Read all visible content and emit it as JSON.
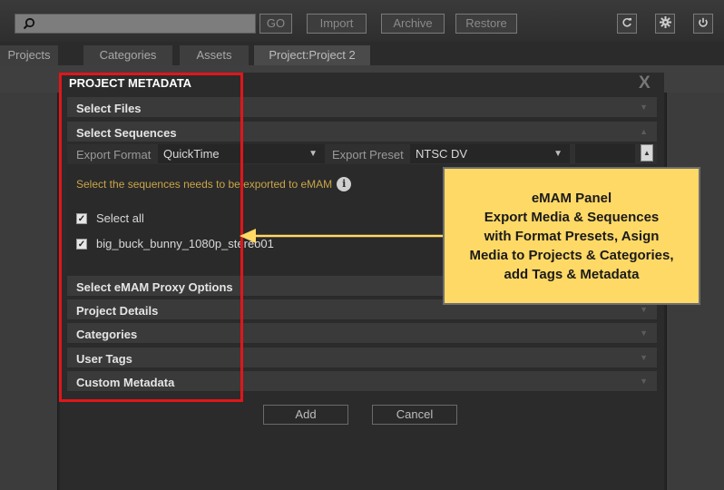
{
  "toolbar": {
    "buttons": {
      "go": "GO",
      "import": "Import",
      "archive": "Archive",
      "restore": "Restore"
    }
  },
  "tabs": [
    "Projects",
    "Categories",
    "Assets",
    "Project:Project 2"
  ],
  "dialog": {
    "title": "PROJECT METADATA",
    "close": "X",
    "sections": {
      "select_files": "Select Files",
      "select_sequences": "Select Sequences",
      "proxy_options": "Select eMAM Proxy Options",
      "project_details": "Project Details",
      "categories": "Categories",
      "user_tags": "User Tags",
      "custom_metadata": "Custom Metadata"
    },
    "export_format_label": "Export Format",
    "export_format_value": "QuickTime",
    "export_preset_label": "Export Preset",
    "export_preset_value": "NTSC DV",
    "instruction": "Select the sequences needs to be exported to eMAM",
    "select_all": "Select all",
    "sequence_item": "big_buck_bunny_1080p_stereo01",
    "add_label": "Add",
    "cancel_label": "Cancel"
  },
  "annotation": {
    "lines": [
      "eMAM Panel",
      "Export Media & Sequences",
      "with Format Presets, Asign",
      "Media to Projects & Categories,",
      "add Tags & Metadata"
    ],
    "callout_color": "#ffd966",
    "highlight_color": "#e0161a"
  }
}
